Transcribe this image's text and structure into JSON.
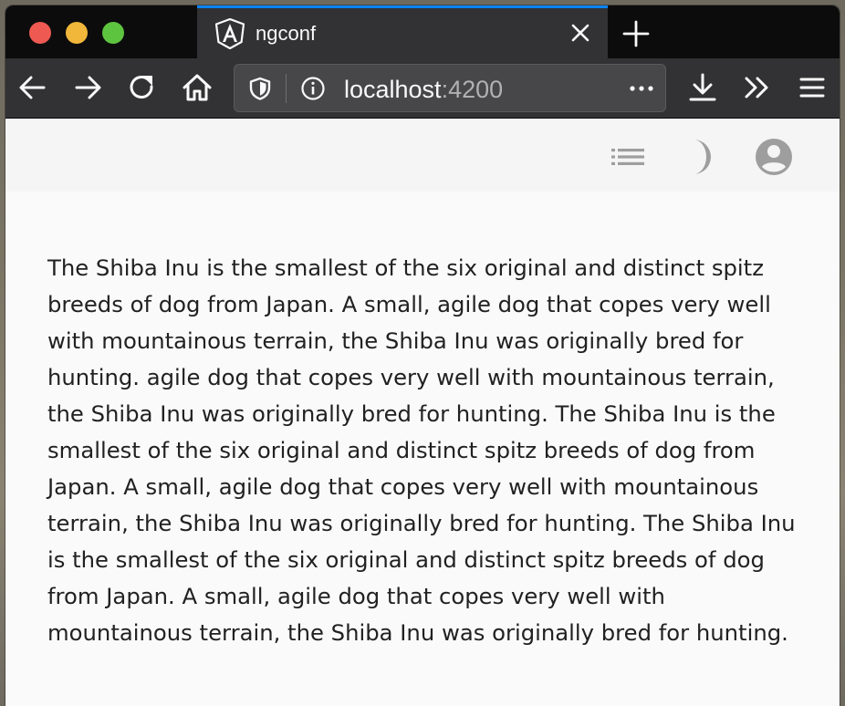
{
  "browser": {
    "tab": {
      "title": "ngconf",
      "favicon": "angular-logo-icon",
      "accent_color": "#0a84ff"
    },
    "url": {
      "host": "localhost",
      "port": ":4200"
    },
    "toolbar_icons": [
      "back-icon",
      "forward-icon",
      "reload-icon",
      "home-icon",
      "download-icon",
      "overflow-chevrons-icon",
      "hamburger-menu-icon"
    ]
  },
  "app": {
    "toolbar_icons": [
      "list-icon",
      "theme-moon-icon",
      "account-circle-icon"
    ],
    "paragraph": "The Shiba Inu is the smallest of the six original and distinct spitz breeds of dog from Japan. A small, agile dog that copes very well with mountainous terrain, the Shiba Inu was originally bred for hunting. agile dog that copes very well with mountainous terrain, the Shiba Inu was originally bred for hunting. The Shiba Inu is the smallest of the six original and distinct spitz breeds of dog from Japan. A small, agile dog that copes very well with mountainous terrain, the Shiba Inu was originally bred for hunting. The Shiba Inu is the smallest of the six original and distinct spitz breeds of dog from Japan. A small, agile dog that copes very well with mountainous terrain, the Shiba Inu was originally bred for hunting."
  }
}
